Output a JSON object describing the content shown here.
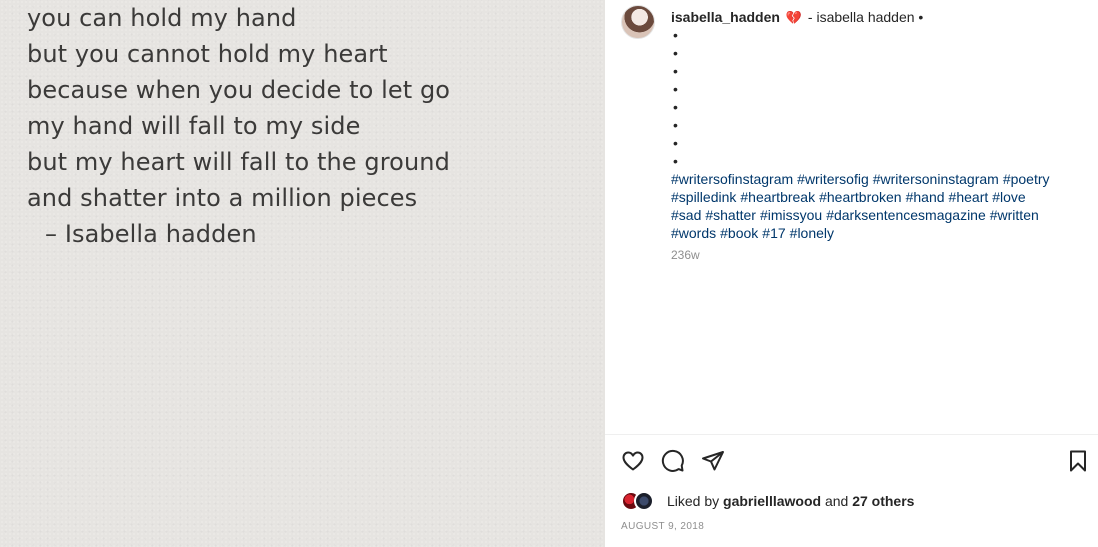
{
  "poem": {
    "lines": [
      "you can hold my hand",
      "but you cannot hold my heart",
      "because when you decide to let go",
      "my hand will fall to my side",
      "but my heart will fall to the ground",
      "and shatter into a million pieces"
    ],
    "signature": "–   Isabella hadden"
  },
  "post": {
    "username": "isabella_hadden",
    "emoji": "💔",
    "caption_suffix": "- isabella hadden •",
    "bullets": [
      "•",
      "•",
      "•",
      "•",
      "•",
      "•",
      "•",
      "•"
    ],
    "hashtags": [
      "#writersofinstagram",
      "#writersofig",
      "#writersoninstagram",
      "#poetry",
      "#spilledink",
      "#heartbreak",
      "#heartbroken",
      "#hand",
      "#heart",
      "#love",
      "#sad",
      "#shatter",
      "#imissyou",
      "#darksentencesmagazine",
      "#written",
      "#words",
      "#book",
      "#17",
      "#lonely"
    ],
    "time_ago": "236w"
  },
  "actions": {
    "like_icon": "heart-icon",
    "comment_icon": "comment-icon",
    "share_icon": "paper-plane-icon",
    "save_icon": "bookmark-icon"
  },
  "likes": {
    "prefix": "Liked by",
    "user": "gabrielllawood",
    "and": "and",
    "others": "27 others"
  },
  "date": "AUGUST 9, 2018",
  "colors": {
    "hashtag": "#00376b",
    "muted": "#8e8e8e",
    "text": "#262626"
  }
}
